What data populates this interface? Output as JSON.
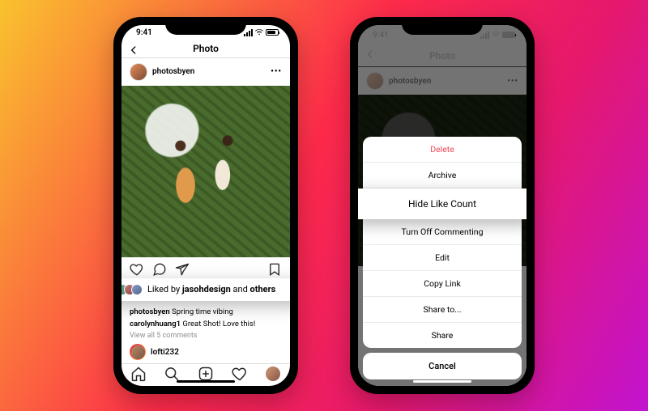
{
  "status": {
    "time": "9:41"
  },
  "nav": {
    "title": "Photo"
  },
  "post": {
    "username": "photosbyen",
    "liked_prefix": "Liked by ",
    "liked_user": "jasohdesign",
    "liked_middle": " and ",
    "liked_suffix": "others",
    "caption_user": "photosbyen",
    "caption_text": " Spring time vibing",
    "comment_user": "carolynhuang1",
    "comment_text": " Great Shot! Love this!",
    "view_all": "View all 5 comments",
    "story_user": "lofti232"
  },
  "sheet": {
    "delete": "Delete",
    "archive": "Archive",
    "hide_like": "Hide Like Count",
    "turn_off": "Turn Off Commenting",
    "edit": "Edit",
    "copy_link": "Copy Link",
    "share_to": "Share to...",
    "share": "Share",
    "cancel": "Cancel"
  }
}
